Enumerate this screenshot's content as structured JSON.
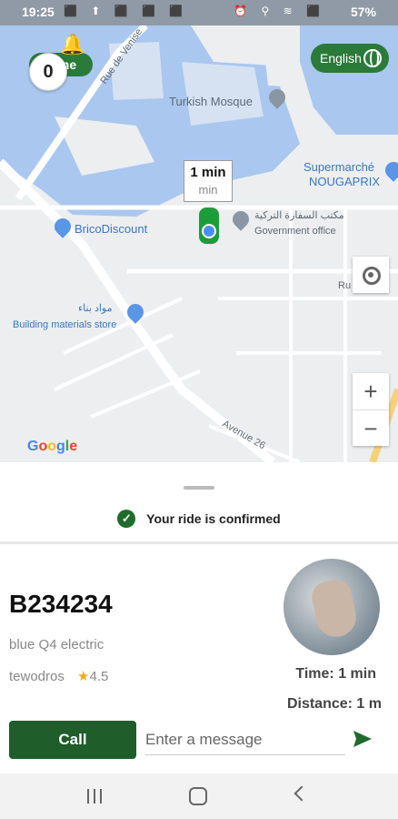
{
  "status_bar": {
    "time": "19:25",
    "battery": "57%",
    "icons_left": "⬛ ⬆ ⬛ ⬛ ⬛",
    "icons_right": "⏰ ⚲ ≋ ⬛"
  },
  "map": {
    "notification_count": "0",
    "online_label": "line",
    "language_button": "English",
    "eta": {
      "value": "1 min",
      "unit": "min"
    },
    "labels": {
      "rue": "Rue de Venise",
      "mosque": "Turkish Mosque",
      "super": "Supermarché",
      "nouga": "NOUGAPRIX",
      "brico": "BricoDiscount",
      "embassy_ar": "مكتب السفارة التركية",
      "gov": "Government office",
      "arabic_mat": "مواد بناء",
      "building": "Building materials store",
      "avenue": "Avenue 26",
      "ru_short": "Ru"
    },
    "zoom_in": "+",
    "zoom_out": "−",
    "google_letters": [
      "G",
      "o",
      "o",
      "g",
      "l",
      "e"
    ],
    "colors": {
      "water": "#a9c7ef",
      "accent": "#2a7a3a"
    }
  },
  "ride": {
    "status": "Your ride is confirmed",
    "plate": "B234234",
    "vehicle": "blue Q4 electric",
    "driver_name": "tewodros",
    "rating": "4.5",
    "time": "Time: 1 min",
    "distance": "Distance: 1 m"
  },
  "actions": {
    "call_label": "Call",
    "message_placeholder": "Enter a message"
  }
}
